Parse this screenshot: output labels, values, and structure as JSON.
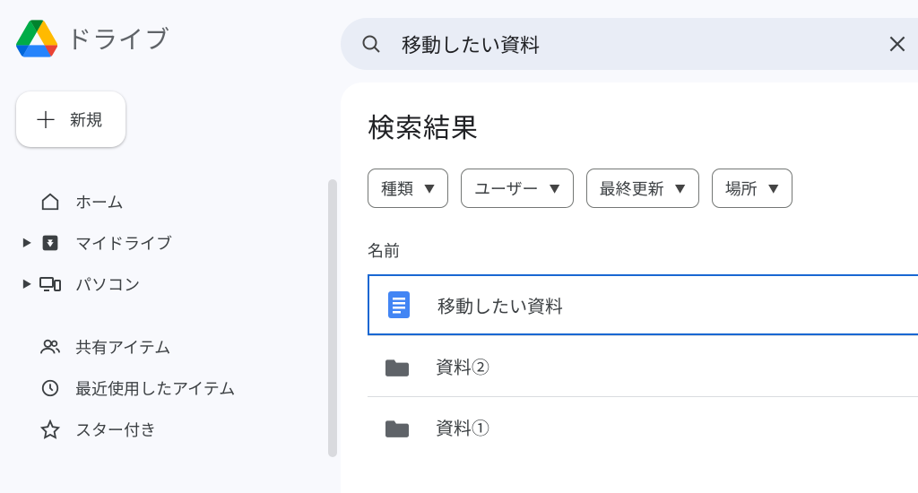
{
  "brand": {
    "name": "ドライブ"
  },
  "new_button": {
    "label": "新規"
  },
  "sidebar": {
    "items": [
      {
        "label": "ホーム",
        "icon": "home",
        "expandable": false
      },
      {
        "label": "マイドライブ",
        "icon": "drive",
        "expandable": true
      },
      {
        "label": "パソコン",
        "icon": "devices",
        "expandable": true
      }
    ],
    "items2": [
      {
        "label": "共有アイテム",
        "icon": "people"
      },
      {
        "label": "最近使用したアイテム",
        "icon": "clock"
      },
      {
        "label": "スター付き",
        "icon": "star"
      }
    ]
  },
  "search": {
    "value": "移動したい資料"
  },
  "main": {
    "title": "検索結果",
    "filters": [
      {
        "label": "種類"
      },
      {
        "label": "ユーザー"
      },
      {
        "label": "最終更新"
      },
      {
        "label": "場所"
      }
    ],
    "column_header": "名前",
    "rows": [
      {
        "name": "移動したい資料",
        "type": "doc",
        "selected": true
      },
      {
        "name": "資料②",
        "type": "folder",
        "selected": false
      },
      {
        "name": "資料①",
        "type": "folder",
        "selected": false
      }
    ]
  }
}
